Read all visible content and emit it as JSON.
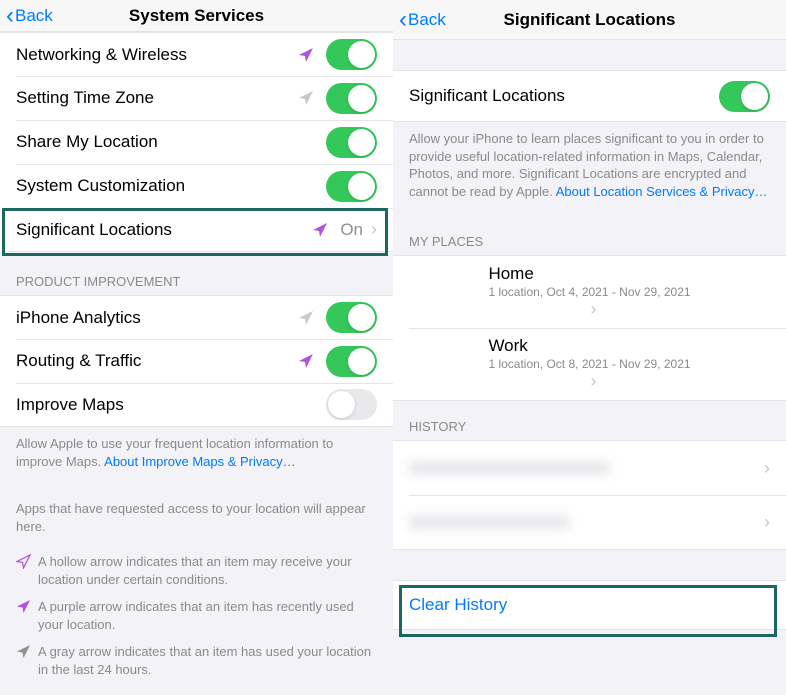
{
  "left": {
    "nav": {
      "back": "Back",
      "title": "System Services"
    },
    "rows": {
      "networking": "Networking & Wireless",
      "timezone": "Setting Time Zone",
      "sharemylocation": "Share My Location",
      "customization": "System Customization",
      "siglocations": "Significant Locations",
      "siglocations_value": "On"
    },
    "sections": {
      "product_improvement": "PRODUCT IMPROVEMENT"
    },
    "rows2": {
      "analytics": "iPhone Analytics",
      "routing": "Routing & Traffic",
      "improvemaps": "Improve Maps"
    },
    "footer_maps": "Allow Apple to use your frequent location information to improve Maps. ",
    "footer_maps_link": "About Improve Maps & Privacy…",
    "footer_apps": "Apps that have requested access to your location will appear here.",
    "legend": {
      "hollow": "A hollow arrow indicates that an item may receive your location under certain conditions.",
      "purple": "A purple arrow indicates that an item has recently used your location.",
      "gray": "A gray arrow indicates that an item has used your location in the last 24 hours."
    }
  },
  "right": {
    "nav": {
      "back": "Back",
      "title": "Significant Locations"
    },
    "toggle_label": "Significant Locations",
    "description": "Allow your iPhone to learn places significant to you in order to provide useful location-related information in Maps, Calendar, Photos, and more. Significant Locations are encrypted and cannot be read by Apple. ",
    "description_link": "About Location Services & Privacy…",
    "sections": {
      "myplaces": "MY PLACES",
      "history": "HISTORY"
    },
    "places": {
      "home": {
        "title": "Home",
        "sub": "1 location, Oct 4, 2021 - Nov 29, 2021"
      },
      "work": {
        "title": "Work",
        "sub": "1 location, Oct 8, 2021 - Nov 29, 2021"
      }
    },
    "clear": "Clear History"
  }
}
